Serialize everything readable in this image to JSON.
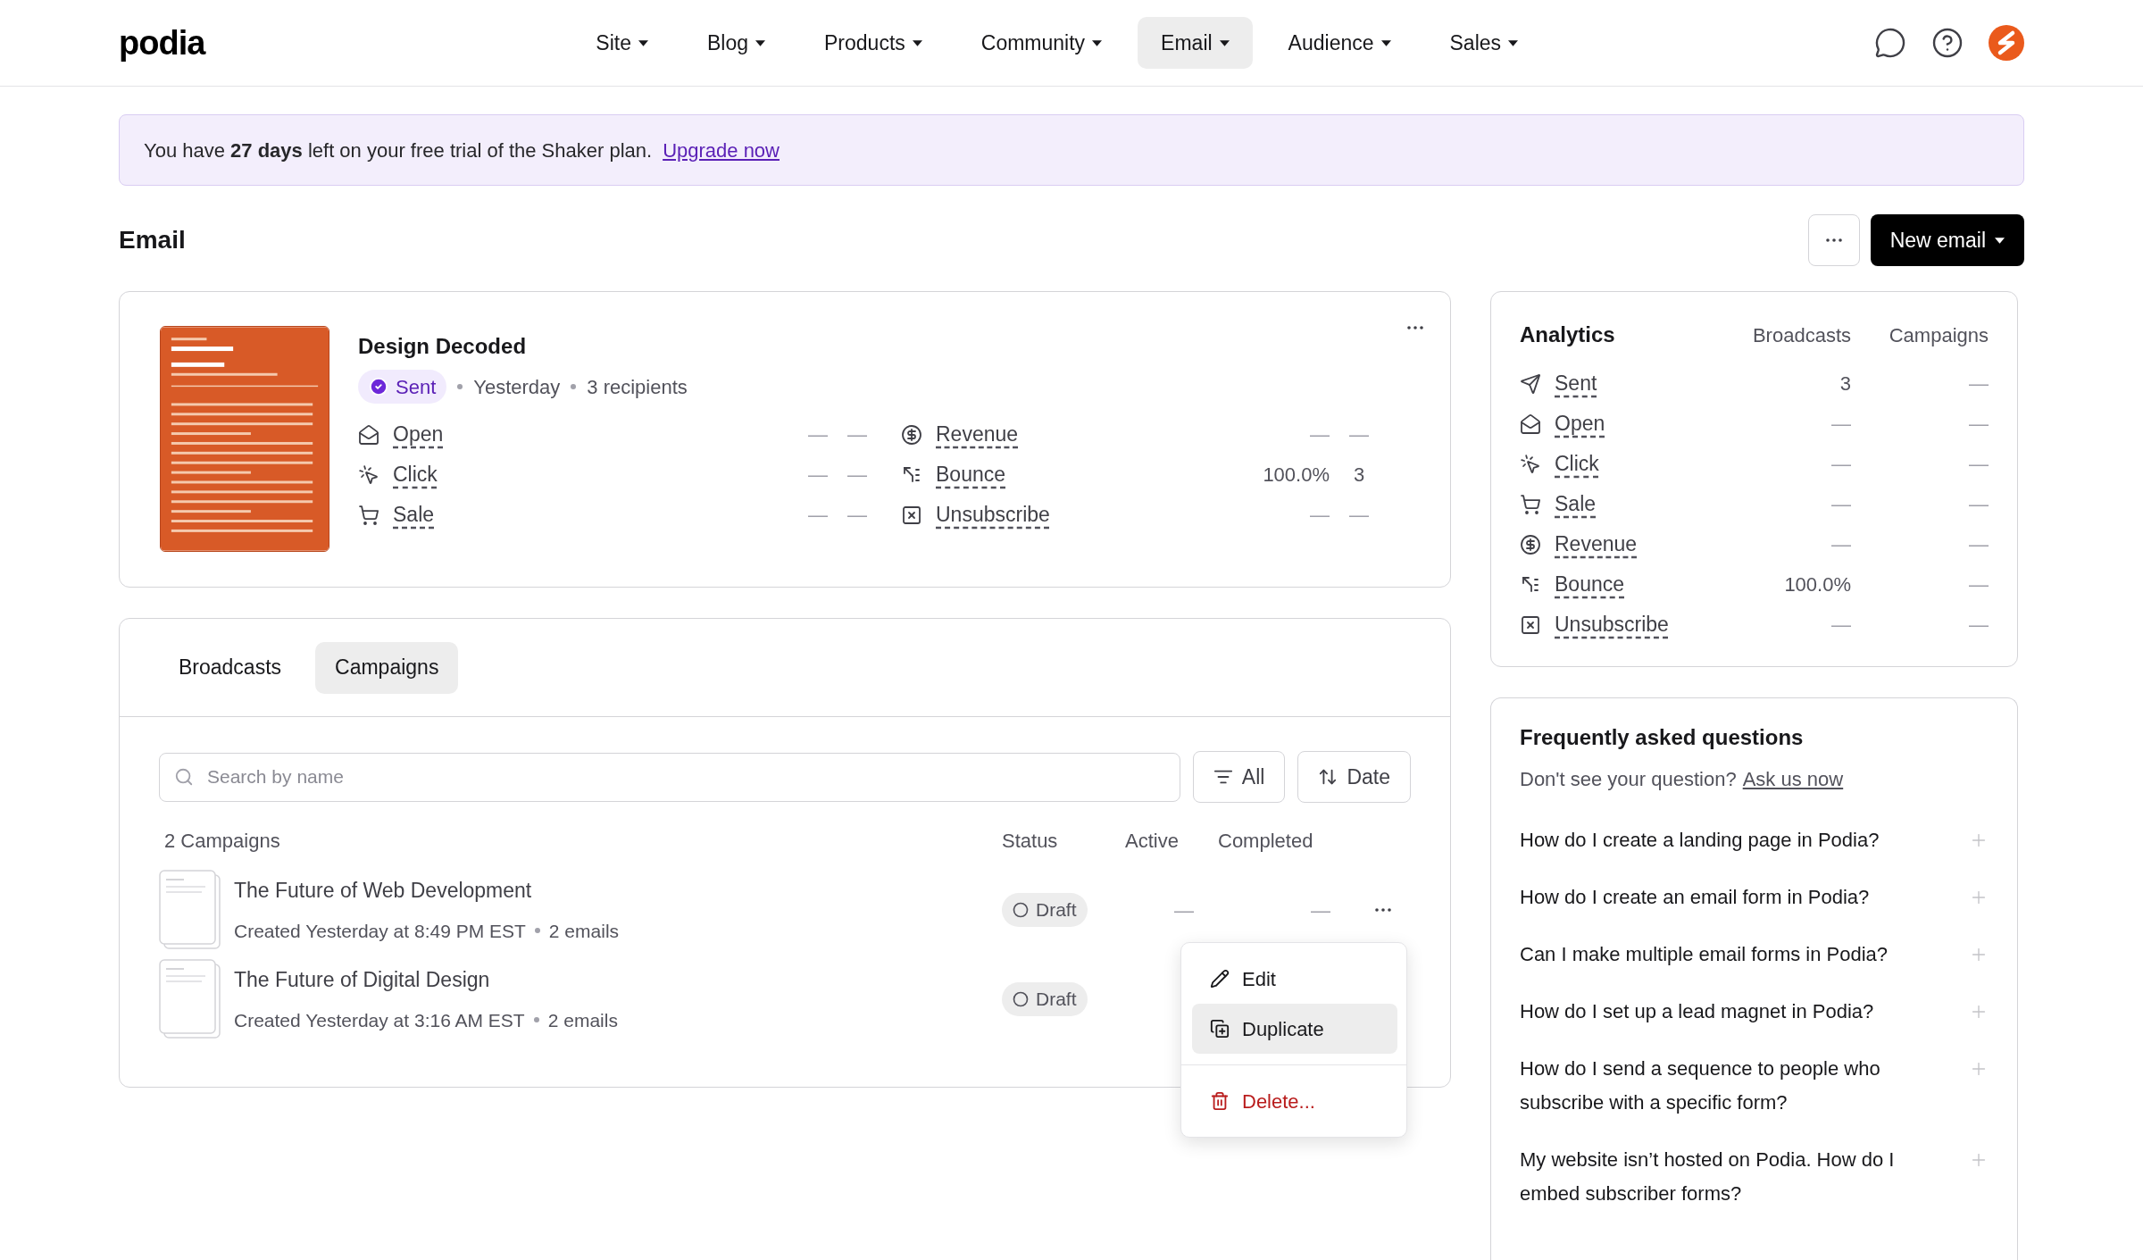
{
  "nav": {
    "logo": "podia",
    "items": [
      {
        "label": "Site",
        "selected": false
      },
      {
        "label": "Blog",
        "selected": false
      },
      {
        "label": "Products",
        "selected": false
      },
      {
        "label": "Community",
        "selected": false
      },
      {
        "label": "Email",
        "selected": true
      },
      {
        "label": "Audience",
        "selected": false
      },
      {
        "label": "Sales",
        "selected": false
      }
    ]
  },
  "banner": {
    "text": "You have **27 days** left on your free trial of the Shaker plan.",
    "link": "Upgrade now"
  },
  "header": {
    "title": "Email",
    "new_email": "New email"
  },
  "email_card": {
    "title": "Design Decoded",
    "status": "Sent",
    "meta": [
      "Yesterday",
      "3 recipients"
    ],
    "metrics_left": [
      {
        "kind": "open",
        "label": "Open",
        "values": [
          "—",
          "—"
        ]
      },
      {
        "kind": "click",
        "label": "Click",
        "values": [
          "—",
          "—"
        ]
      },
      {
        "kind": "sale",
        "label": "Sale",
        "values": [
          "—",
          "—"
        ]
      }
    ],
    "metrics_right": [
      {
        "kind": "revenue",
        "label": "Revenue",
        "values": [
          "—",
          "—"
        ]
      },
      {
        "kind": "bounce",
        "label": "Bounce",
        "values": [
          "100.0%",
          "3"
        ]
      },
      {
        "kind": "unsubscribe",
        "label": "Unsubscribe",
        "values": [
          "—",
          "—"
        ]
      }
    ]
  },
  "tabs": [
    {
      "label": "Broadcasts",
      "selected": false
    },
    {
      "label": "Campaigns",
      "selected": true
    }
  ],
  "search": {
    "placeholder": "Search by name"
  },
  "filter": "All",
  "sort": "Date",
  "campaigns": {
    "count": "2 Campaigns",
    "columns": [
      "Status",
      "Active",
      "Completed"
    ],
    "rows": [
      {
        "title": "The Future of Web Development",
        "created": "Created Yesterday at 8:49 PM EST",
        "emails": "2 emails",
        "status": "Draft",
        "active": "—",
        "completed": "—"
      },
      {
        "title": "The Future of Digital Design",
        "created": "Created Yesterday at 3:16 AM EST",
        "emails": "2 emails",
        "status": "Draft"
      }
    ]
  },
  "menu": [
    {
      "kind": "edit",
      "label": "Edit",
      "selected": false
    },
    {
      "kind": "duplicate",
      "label": "Duplicate",
      "selected": true
    },
    {
      "kind": "delete",
      "label": "Delete..."
    }
  ],
  "analytics": {
    "title": "Analytics",
    "columns": [
      "Broadcasts",
      "Campaigns"
    ],
    "rows": [
      {
        "kind": "sent",
        "label": "Sent",
        "values": [
          "3",
          "—"
        ]
      },
      {
        "kind": "open",
        "label": "Open",
        "values": [
          "—",
          "—"
        ]
      },
      {
        "kind": "click",
        "label": "Click",
        "values": [
          "—",
          "—"
        ]
      },
      {
        "kind": "sale",
        "label": "Sale",
        "values": [
          "—",
          "—"
        ]
      },
      {
        "kind": "revenue",
        "label": "Revenue",
        "values": [
          "—",
          "—"
        ]
      },
      {
        "kind": "bounce",
        "label": "Bounce",
        "values": [
          "100.0%",
          "—"
        ]
      },
      {
        "kind": "unsubscribe",
        "label": "Unsubscribe",
        "values": [
          "—",
          "—"
        ]
      }
    ]
  },
  "faq": {
    "title": "Frequently asked questions",
    "prompt": "Don't see your question?",
    "link": "Ask us now",
    "items": [
      {
        "question": "How do I create a landing page in Podia?",
        "expanded": false
      },
      {
        "question": "How do I create an email form in Podia?",
        "expanded": false
      },
      {
        "question": "Can I make multiple email forms in Podia?",
        "expanded": false
      },
      {
        "question": "How do I set up a lead magnet in Podia?",
        "expanded": false
      },
      {
        "question": "How do I send a sequence to people who subscribe with a specific form?",
        "expanded": false
      },
      {
        "question": "My website isn’t hosted on Podia. How do I embed subscriber forms?",
        "expanded": false
      }
    ]
  }
}
